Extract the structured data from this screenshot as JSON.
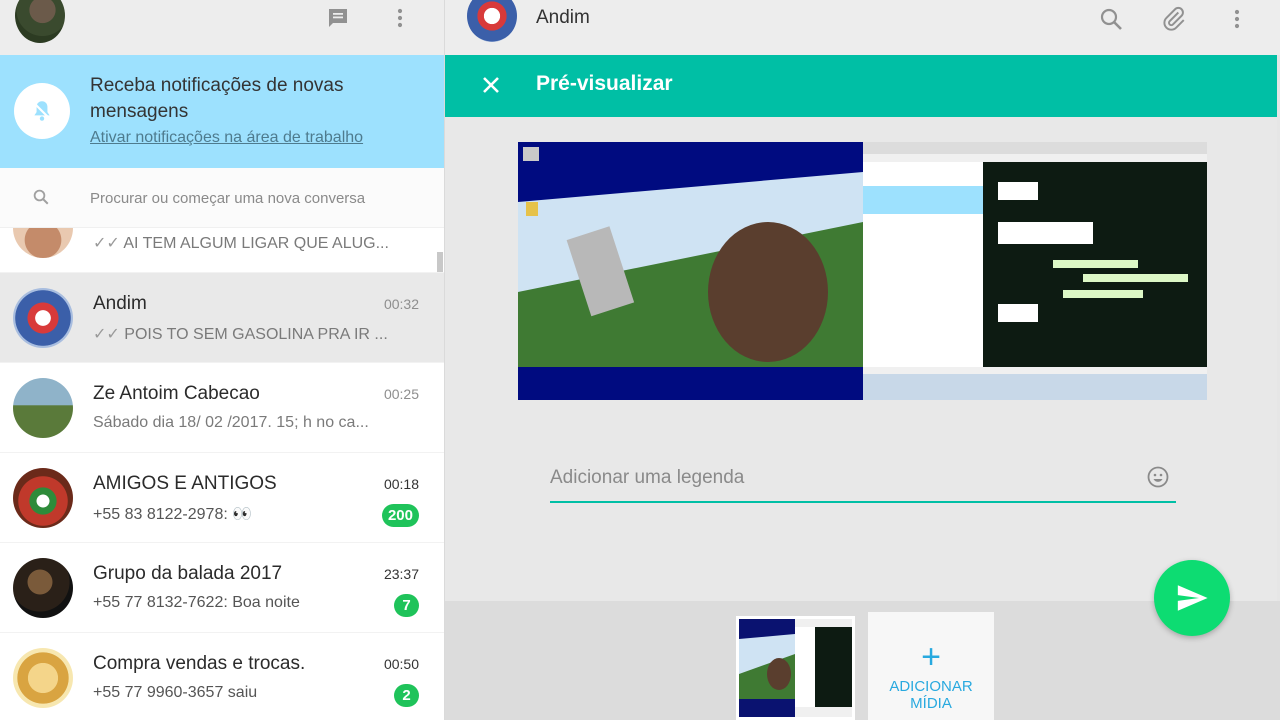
{
  "notification_banner": {
    "title": "Receba notificações de novas mensagens",
    "link": "Ativar notificações na área de trabalho"
  },
  "search": {
    "placeholder": "Procurar ou começar uma nova conversa"
  },
  "chats": [
    {
      "name": "",
      "time": "",
      "last_message": "AI TEM ALGUM LIGAR QUE ALUG...",
      "tick": "✓✓",
      "badge": ""
    },
    {
      "name": "Andim",
      "time": "00:32",
      "last_message": "POIS TO SEM GASOLINA PRA IR ...",
      "tick": "✓✓",
      "badge": ""
    },
    {
      "name": "Ze Antoim Cabecao",
      "time": "00:25",
      "last_message": "Sábado dia 18/ 02 /2017. 15; h no ca...",
      "tick": "",
      "badge": ""
    },
    {
      "name": "AMIGOS E ANTIGOS",
      "time": "00:18",
      "last_message": "+55 83 8122-2978: 👀",
      "tick": "",
      "badge": "200"
    },
    {
      "name": "Grupo da balada 2017",
      "time": "23:37",
      "last_message": "+55 77 8132-7622: Boa noite",
      "tick": "",
      "badge": "7"
    },
    {
      "name": "Compra vendas e trocas.",
      "time": "00:50",
      "last_message": "+55 77 9960-3657 saiu",
      "tick": "",
      "badge": "2"
    }
  ],
  "conversation": {
    "contact_name": "Andim"
  },
  "preview": {
    "title": "Pré-visualizar",
    "caption_placeholder": "Adicionar uma legenda",
    "add_media_plus": "+",
    "add_media_label_line1": "ADICIONAR",
    "add_media_label_line2": "MÍDIA"
  },
  "colors": {
    "accent": "#00bfa5",
    "notification_bg": "#9de1fe",
    "badge": "#1fc35a",
    "send_button": "#0ddc72",
    "add_media": "#28a9df"
  }
}
